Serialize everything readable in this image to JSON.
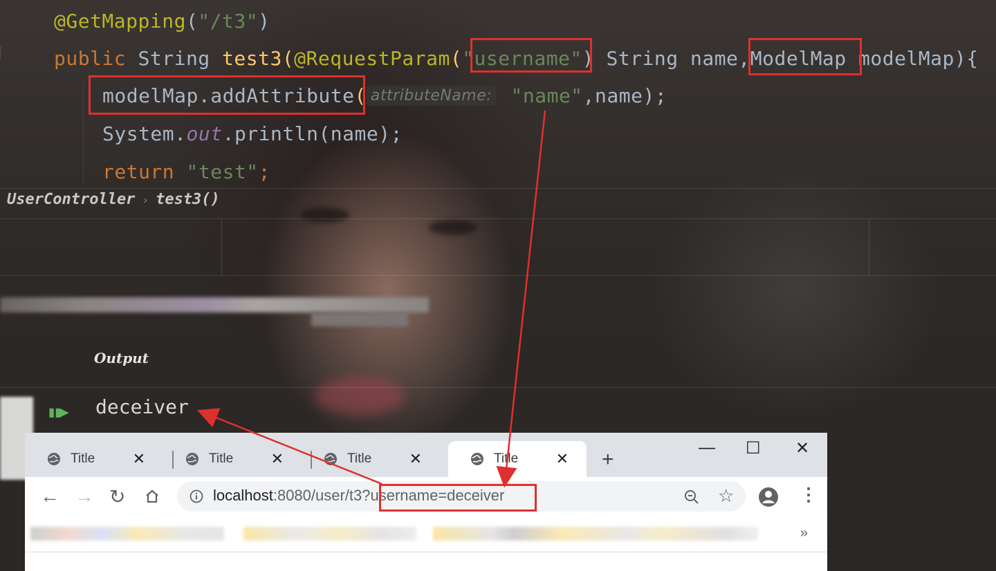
{
  "editor": {
    "line1": {
      "ann": "@GetMapping",
      "paren_open": "(",
      "str": "\"/t3\"",
      "paren_close": ")"
    },
    "line2": {
      "kw": "public",
      "type": " String ",
      "method": "test3",
      "paren_open": "(",
      "ann": "@RequestParam",
      "paren2": "(",
      "str": "\"username\"",
      "after": ") String name,",
      "type2": "ModelMap",
      "param": " modelMap){"
    },
    "line3": {
      "obj": "modelMap.addAttribute",
      "open": "(",
      "hint": "attributeName:",
      "str": " \"name\"",
      "rest": ",name);"
    },
    "line4": {
      "obj": "System.",
      "static": "out",
      "rest": ".println(name);"
    },
    "line5": {
      "kw": "return",
      "str": " \"test\"",
      "rest": ";"
    }
  },
  "breadcrumb": {
    "class": "UserController",
    "sep": "›",
    "method": "test3()"
  },
  "console": {
    "label": "Output",
    "output": "deceiver",
    "run_icon": "run-output-icon"
  },
  "browser": {
    "tabs": [
      {
        "label": "Title",
        "close": "✕"
      },
      {
        "label": "Title",
        "close": "✕"
      },
      {
        "label": "Title",
        "close": "✕"
      },
      {
        "label": "Title",
        "close": "✕"
      }
    ],
    "new_tab": "+",
    "window_controls": {
      "minimize": "—",
      "maximize": "☐",
      "close": "✕"
    },
    "url_host": "localhost",
    "url_rest": ":8080/user/t3?username=deceiver",
    "bookmarks_overflow": "»"
  },
  "colors": {
    "highlight": "#e0302d",
    "annotation": "#bbb529",
    "keyword": "#cc7832",
    "string": "#6a8759"
  }
}
